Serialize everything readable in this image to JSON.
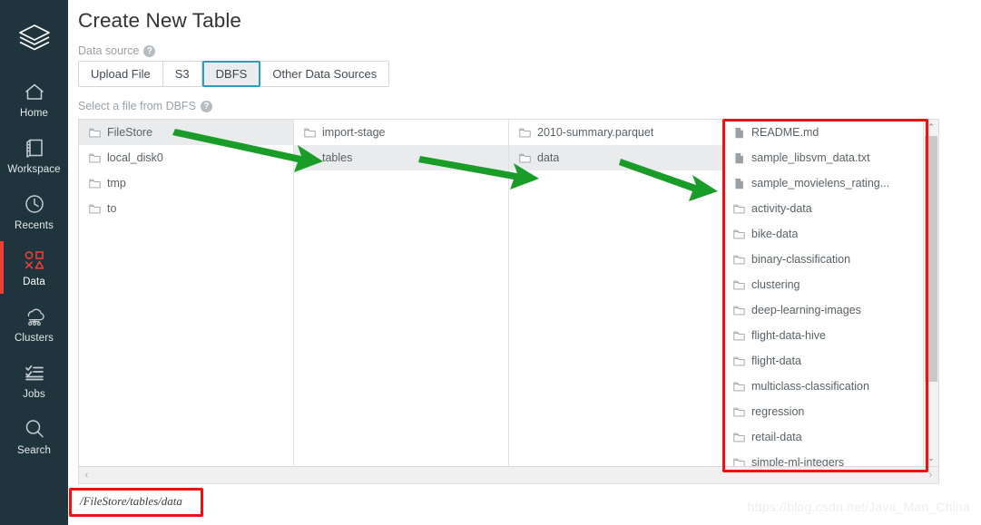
{
  "sidebar": {
    "logo_name": "databricks-logo",
    "items": [
      {
        "label": "Home",
        "icon": "home-icon",
        "active": false
      },
      {
        "label": "Workspace",
        "icon": "workspace-icon",
        "active": false
      },
      {
        "label": "Recents",
        "icon": "clock-icon",
        "active": false
      },
      {
        "label": "Data",
        "icon": "data-icon",
        "active": true
      },
      {
        "label": "Clusters",
        "icon": "clusters-icon",
        "active": false
      },
      {
        "label": "Jobs",
        "icon": "jobs-icon",
        "active": false
      },
      {
        "label": "Search",
        "icon": "search-icon",
        "active": false
      }
    ],
    "active_color": "#ed3f35",
    "background": "#1f343c"
  },
  "page": {
    "title": "Create New Table"
  },
  "data_source": {
    "label": "Data source",
    "help_glyph": "?",
    "tabs": [
      {
        "label": "Upload File",
        "selected": false
      },
      {
        "label": "S3",
        "selected": false
      },
      {
        "label": "DBFS",
        "selected": true
      },
      {
        "label": "Other Data Sources",
        "selected": false
      }
    ],
    "selected_border_color": "#2a9fb5"
  },
  "file_picker": {
    "label": "Select a file from DBFS",
    "help_glyph": "?",
    "columns": [
      {
        "name": "column-root",
        "items": [
          {
            "label": "FileStore",
            "type": "folder",
            "selected": true
          },
          {
            "label": "local_disk0",
            "type": "folder",
            "selected": false
          },
          {
            "label": "tmp",
            "type": "folder",
            "selected": false
          },
          {
            "label": "to",
            "type": "folder",
            "selected": false
          }
        ]
      },
      {
        "name": "column-filestore",
        "items": [
          {
            "label": "import-stage",
            "type": "folder",
            "selected": false
          },
          {
            "label": "tables",
            "type": "folder",
            "selected": true
          }
        ]
      },
      {
        "name": "column-tables",
        "items": [
          {
            "label": "2010-summary.parquet",
            "type": "folder",
            "selected": false
          },
          {
            "label": "data",
            "type": "folder",
            "selected": true
          }
        ]
      },
      {
        "name": "column-data",
        "items": [
          {
            "label": "README.md",
            "type": "file",
            "selected": false
          },
          {
            "label": "sample_libsvm_data.txt",
            "type": "file",
            "selected": false
          },
          {
            "label": "sample_movielens_rating...",
            "type": "file",
            "selected": false
          },
          {
            "label": "activity-data",
            "type": "folder",
            "selected": false
          },
          {
            "label": "bike-data",
            "type": "folder",
            "selected": false
          },
          {
            "label": "binary-classification",
            "type": "folder",
            "selected": false
          },
          {
            "label": "clustering",
            "type": "folder",
            "selected": false
          },
          {
            "label": "deep-learning-images",
            "type": "folder",
            "selected": false
          },
          {
            "label": "flight-data-hive",
            "type": "folder",
            "selected": false
          },
          {
            "label": "flight-data",
            "type": "folder",
            "selected": false
          },
          {
            "label": "multiclass-classification",
            "type": "folder",
            "selected": false
          },
          {
            "label": "regression",
            "type": "folder",
            "selected": false
          },
          {
            "label": "retail-data",
            "type": "folder",
            "selected": false
          },
          {
            "label": "simple-ml-integers",
            "type": "folder",
            "selected": false
          }
        ]
      }
    ],
    "vertical_scrollbar": {
      "up_glyph": "⌃",
      "down_glyph": "⌄"
    },
    "horizontal_scrollbar": {
      "left_glyph": "‹",
      "right_glyph": "›"
    }
  },
  "selected_path": "/FileStore/tables/data",
  "watermark": "https://blog.csdn.net/Java_Man_China",
  "annotations": {
    "highlight_color": "#f20f0f",
    "arrow_color": "#1a9c29",
    "arrows": [
      {
        "name": "arrow-filestore-to-tables"
      },
      {
        "name": "arrow-tables-to-data"
      },
      {
        "name": "arrow-data-to-files"
      }
    ]
  }
}
